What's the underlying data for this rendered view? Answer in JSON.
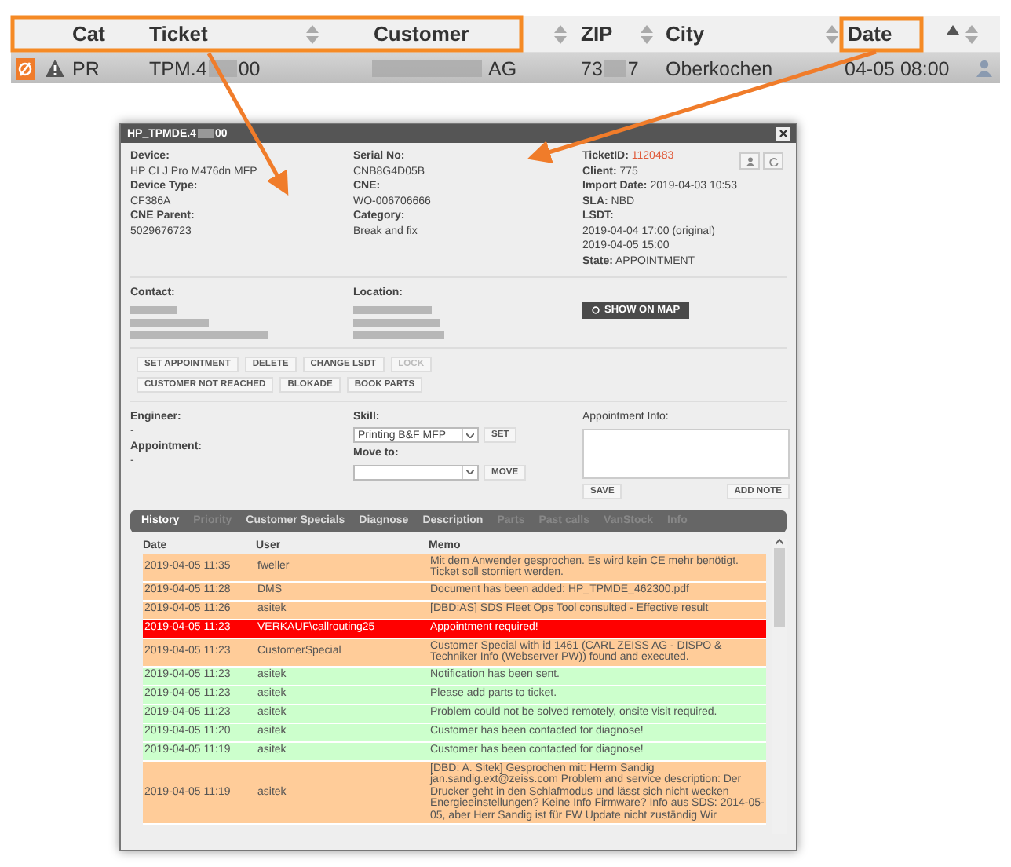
{
  "list": {
    "columns": [
      {
        "label": "Cat",
        "sorted": false
      },
      {
        "label": "Ticket",
        "sorted": false
      },
      {
        "label": "Customer",
        "sorted": false
      },
      {
        "label": "ZIP",
        "sorted": false
      },
      {
        "label": "City",
        "sorted": false
      },
      {
        "label": "Date",
        "sorted": true
      }
    ],
    "row": {
      "cat": "PR",
      "ticket_start": "TPM.4",
      "ticket_end": "00",
      "customer_end": "AG",
      "zip_start": "73",
      "zip_end": "7",
      "city": "Oberkochen",
      "date": "04-05 08:00"
    }
  },
  "dialog": {
    "title_start": "HP_TPMDE.4",
    "title_end": "00",
    "device_fields": [
      {
        "label": "Device:",
        "value": "HP CLJ Pro M476dn MFP"
      },
      {
        "label": "Device Type:",
        "value": "CF386A"
      },
      {
        "label": "CNE Parent:",
        "value": "5029676723"
      }
    ],
    "serial_fields": [
      {
        "label": "Serial No:",
        "value": "CNB8G4D05B"
      },
      {
        "label": "CNE:",
        "value": "WO-006706666"
      },
      {
        "label": "Category:",
        "value": "Break and fix"
      }
    ],
    "status_fields": [
      {
        "kind": "highlight",
        "label": "TicketID:",
        "value": "1120483"
      },
      {
        "kind": "inline",
        "label": "Client:",
        "value": "775"
      },
      {
        "kind": "inline",
        "label": "Import Date:",
        "value": "2019-04-03 10:53"
      },
      {
        "kind": "inline",
        "label": "SLA:",
        "value": "NBD"
      },
      {
        "kind": "block",
        "label": "LSDT:",
        "lines": [
          "2019-04-04 17:00 (original)",
          "2019-04-05 15:00"
        ]
      },
      {
        "kind": "inline",
        "label": "State:",
        "value": "APPOINTMENT"
      }
    ],
    "contact_label": "Contact:",
    "location_label": "Location:",
    "map_button": "SHOW ON MAP",
    "actions": [
      [
        {
          "label": "SET APPOINTMENT",
          "disabled": false
        },
        {
          "label": "DELETE",
          "disabled": false
        },
        {
          "label": "CHANGE LSDT",
          "disabled": false
        },
        {
          "label": "LOCK",
          "disabled": true
        }
      ],
      [
        {
          "label": "CUSTOMER NOT REACHED",
          "disabled": false
        },
        {
          "label": "BLOKADE",
          "disabled": false
        },
        {
          "label": "BOOK PARTS",
          "disabled": false
        }
      ]
    ],
    "engineer": {
      "label": "Engineer:",
      "value": "-"
    },
    "appointment": {
      "label": "Appointment:",
      "value": "-"
    },
    "skill": {
      "label": "Skill:",
      "value": "Printing B&F MFP",
      "button": "SET"
    },
    "move": {
      "label": "Move to:",
      "button": "MOVE"
    },
    "appointment_info": {
      "label": "Appointment Info:",
      "save": "SAVE",
      "add_note": "ADD NOTE"
    },
    "tabs": [
      {
        "label": "History",
        "selected": true,
        "disabled": false
      },
      {
        "label": "Priority",
        "selected": false,
        "disabled": true
      },
      {
        "label": "Customer Specials",
        "selected": false,
        "disabled": false
      },
      {
        "label": "Diagnose",
        "selected": false,
        "disabled": false
      },
      {
        "label": "Description",
        "selected": false,
        "disabled": false
      },
      {
        "label": "Parts",
        "selected": false,
        "disabled": true
      },
      {
        "label": "Past calls",
        "selected": false,
        "disabled": true
      },
      {
        "label": "VanStock",
        "selected": false,
        "disabled": true
      },
      {
        "label": "Info",
        "selected": false,
        "disabled": true
      }
    ],
    "history": {
      "columns": [
        "Date",
        "User",
        "Memo"
      ],
      "rows": [
        {
          "date": "2019-04-05 11:35",
          "user": "fweller",
          "memo": "Mit dem Anwender gesprochen. Es wird kein CE mehr benötigt. Ticket soll storniert werden.",
          "color": "#ffcc99"
        },
        {
          "date": "2019-04-05 11:28",
          "user": "DMS",
          "memo": "Document has been added: HP_TPMDE_462300.pdf",
          "color": "#ffcc99"
        },
        {
          "date": "2019-04-05 11:26",
          "user": "asitek",
          "memo": "[DBD:AS] SDS Fleet Ops Tool consulted - Effective result",
          "color": "#ffcc99"
        },
        {
          "date": "2019-04-05 11:23",
          "user": "VERKAUF\\callrouting25",
          "memo": "Appointment required!",
          "color": "#ff0000"
        },
        {
          "date": "2019-04-05 11:23",
          "user": "CustomerSpecial",
          "memo": "Customer Special with id 1461 (CARL ZEISS AG - DISPO & Techniker Info (Webserver PW)) found and executed.",
          "color": "#ffcc99"
        },
        {
          "date": "2019-04-05 11:23",
          "user": "asitek",
          "memo": "Notification has been sent.",
          "color": "#ccffcc"
        },
        {
          "date": "2019-04-05 11:23",
          "user": "asitek",
          "memo": "Please add parts to ticket.",
          "color": "#ccffcc"
        },
        {
          "date": "2019-04-05 11:23",
          "user": "asitek",
          "memo": "Problem could not be solved remotely, onsite visit required.",
          "color": "#ccffcc"
        },
        {
          "date": "2019-04-05 11:20",
          "user": "asitek",
          "memo": "Customer has been contacted for diagnose!",
          "color": "#ccffcc"
        },
        {
          "date": "2019-04-05 11:19",
          "user": "asitek",
          "memo": "Customer has been contacted for diagnose!",
          "color": "#ccffcc"
        },
        {
          "date": "2019-04-05 11:19",
          "user": "asitek",
          "memo": "[DBD: A. Sitek] Gesprochen mit: Herrn Sandig jan.sandig.ext@zeiss.com Problem and service description: Der Drucker geht in den Schlafmodus und lässt sich nicht wecken Energieeinstellungen? Keine Info Firmware? Info aus SDS: 2014-05-05, aber Herr Sandig ist für FW Update nicht zuständig Wir",
          "color": "#ffcc99"
        }
      ]
    }
  }
}
